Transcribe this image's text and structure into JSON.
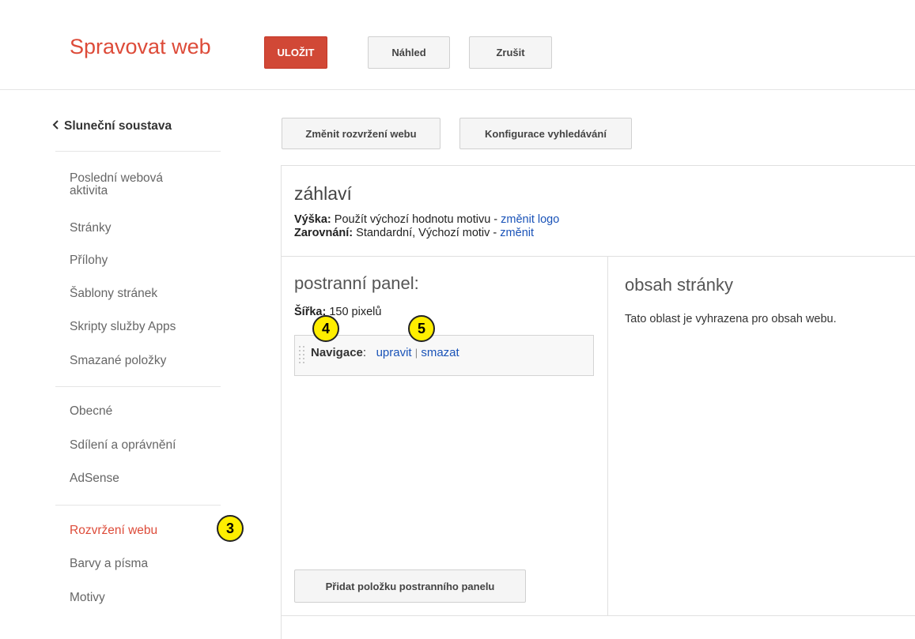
{
  "header": {
    "title": "Spravovat web",
    "save_label": "ULOŽIT",
    "preview_label": "Náhled",
    "cancel_label": "Zrušit"
  },
  "sidebar": {
    "back_label": "Sluneční soustava",
    "group1": [
      "Poslední webová\naktivita",
      "Stránky",
      "Přílohy",
      "Šablony stránek",
      "Skripty služby Apps",
      "Smazané položky"
    ],
    "group2": [
      "Obecné",
      "Sdílení a oprávnění",
      "AdSense"
    ],
    "group3": [
      "Rozvržení webu",
      "Barvy a písma",
      "Motivy"
    ],
    "active": "Rozvržení webu"
  },
  "toolbar": {
    "change_layout": "Změnit rozvržení webu",
    "search_config": "Konfigurace vyhledávání"
  },
  "layout_header": {
    "title": "záhlaví",
    "height_label": "Výška:",
    "height_value": " Použít výchozí hodnotu motivu - ",
    "height_link": "změnit logo",
    "align_label": "Zarovnání:",
    "align_value": " Standardní, Výchozí motiv - ",
    "align_link": "změnit"
  },
  "sidebar_panel": {
    "title": "postranní panel:",
    "width_label": "Šířka:",
    "width_value": " 150 pixelů",
    "gadget_name": "Navigace",
    "gadget_colon": ":",
    "edit_link": "upravit",
    "separator": "|",
    "delete_link": "smazat",
    "add_button": "Přidat položku postranního panelu"
  },
  "content_panel": {
    "title": "obsah stránky",
    "description": "Tato oblast je vyhrazena pro obsah webu."
  },
  "annotations": [
    "3",
    "4",
    "5"
  ]
}
